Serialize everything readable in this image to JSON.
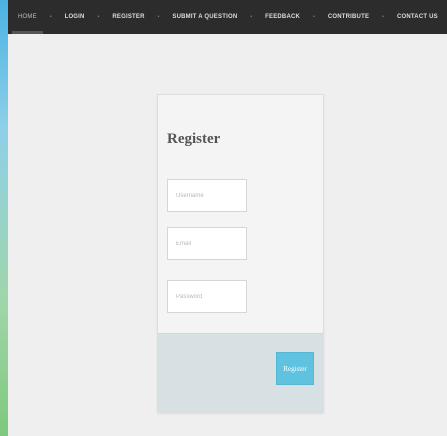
{
  "nav": {
    "items": [
      {
        "label": "HOME"
      },
      {
        "label": "LOGIN"
      },
      {
        "label": "REGISTER"
      },
      {
        "label": "SUBMIT A QUESTION"
      },
      {
        "label": "FEEDBACK"
      },
      {
        "label": "CONTRIBUTE"
      },
      {
        "label": "CONTACT US"
      }
    ],
    "separator": "•"
  },
  "register_form": {
    "title": "Register",
    "username_placeholder": "Username",
    "email_placeholder": "Email",
    "password_placeholder": "Password",
    "submit_label": "Register"
  },
  "colors": {
    "navbar_bg": "#2c2c2c",
    "page_bg": "#efefef",
    "card_footer_bg": "#d7e0e2",
    "button_accent": "#5fc3df"
  }
}
